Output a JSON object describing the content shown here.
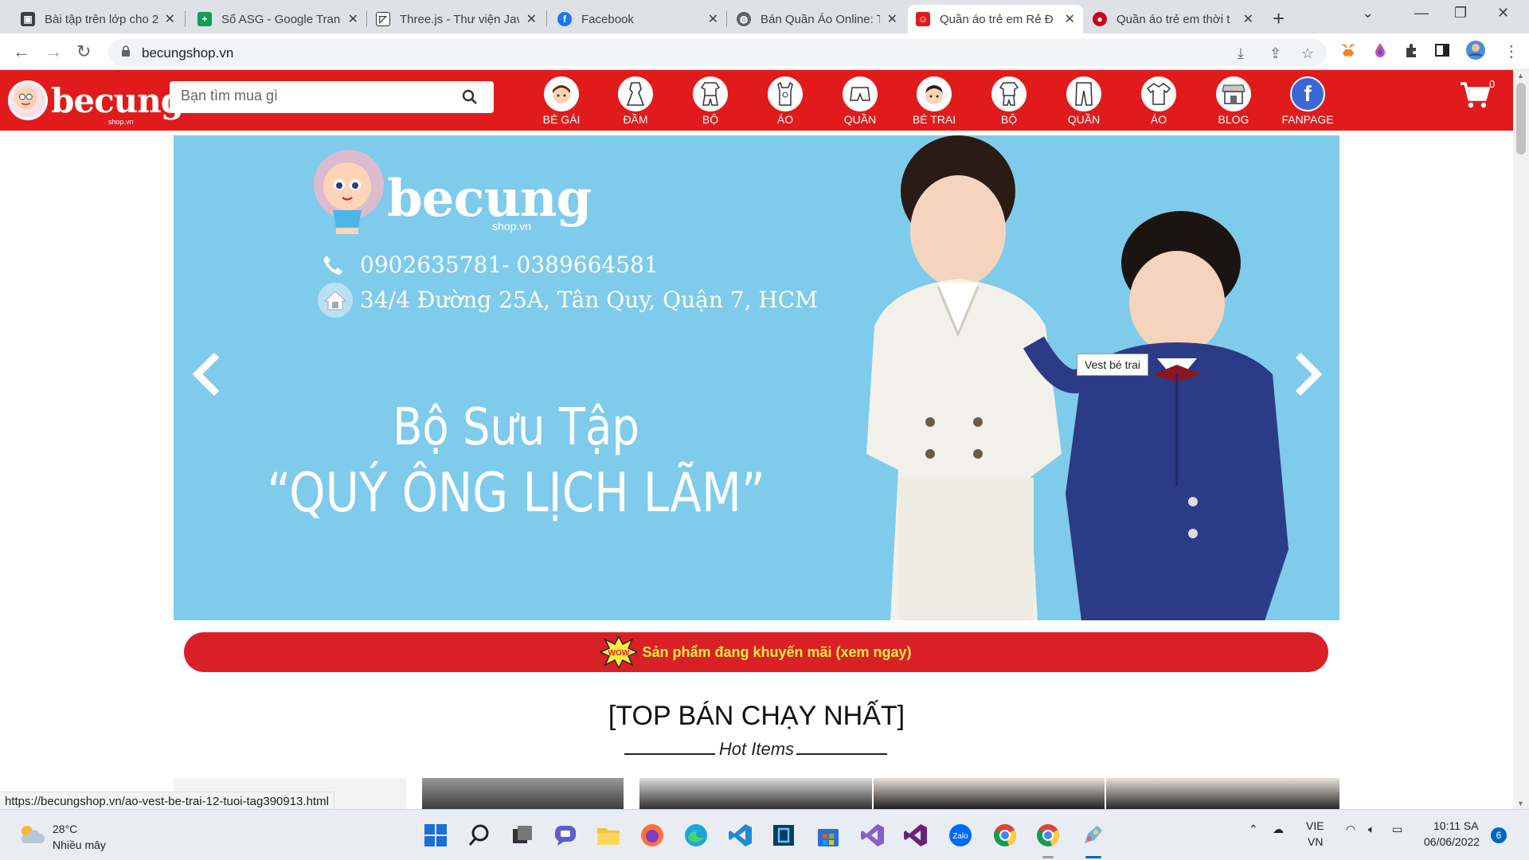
{
  "browser": {
    "tabs": [
      {
        "title": "Bài tập trên lớp cho 2",
        "favicon": "classroom-icon",
        "color": "#3c4043"
      },
      {
        "title": "Số ASG - Google Trang",
        "favicon": "sheets-icon",
        "color": "#0f9d58"
      },
      {
        "title": "Three.js - Thư viện Jav",
        "favicon": "threejs-icon",
        "color": "#333333"
      },
      {
        "title": "Facebook",
        "favicon": "facebook-icon",
        "color": "#1877f2"
      },
      {
        "title": "Bán Quần Áo Online: T",
        "favicon": "globe-icon",
        "color": "#5f6368"
      },
      {
        "title": "Quần áo trẻ em Rẻ Đ",
        "favicon": "becung-icon",
        "color": "#e11b1b"
      },
      {
        "title": "Quần áo trẻ em thời t",
        "favicon": "red-logo-icon",
        "color": "#d0021b"
      }
    ],
    "active_tab": 5,
    "url": "becungshop.vn"
  },
  "site": {
    "logo_text": "becung",
    "logo_sub": "shop.vn",
    "search_placeholder": "Bạn tìm mua gì",
    "categories": [
      {
        "label": "BÉ GÁI",
        "icon": "girl-icon"
      },
      {
        "label": "ĐẦM",
        "icon": "dress-icon"
      },
      {
        "label": "BỘ",
        "icon": "girl-set-icon"
      },
      {
        "label": "ÁO",
        "icon": "tanktop-icon"
      },
      {
        "label": "QUẦN",
        "icon": "shorts-icon"
      },
      {
        "label": "BÉ TRAI",
        "icon": "boy-icon"
      },
      {
        "label": "BỘ",
        "icon": "boy-set-icon"
      },
      {
        "label": "QUẦN",
        "icon": "pants-icon"
      },
      {
        "label": "ÁO",
        "icon": "shirt-icon"
      },
      {
        "label": "BLOG",
        "icon": "store-icon"
      },
      {
        "label": "FANPAGE",
        "icon": "facebook-icon"
      }
    ],
    "cart_count": "0"
  },
  "banner": {
    "logo_text": "becung",
    "logo_sub": "shop.vn",
    "phone": "0902635781- 0389664581",
    "address": "34/4 Đường 25A, Tân Quy, Quận 7, HCM",
    "title_line1": "Bộ Sưu Tập",
    "title_line2": "“QUÝ ÔNG LỊCH LÃM”",
    "tooltip": "Vest bé trai",
    "bg_color": "#7fcbeb"
  },
  "promo": {
    "text": "Sản phẩm đang khuyến mãi (xem ngay)",
    "badge": "WOW"
  },
  "sections": {
    "top_title": "[TOP BÁN CHẠY NHẤT]",
    "hot_items": "Hot Items"
  },
  "status_url": "https://becungshop.vn/ao-vest-be-trai-12-tuoi-tag390913.html",
  "taskbar": {
    "temperature": "28°C",
    "weather": "Nhiều mây",
    "lang1": "VIE",
    "lang2": "VN",
    "time": "10:11 SA",
    "date": "06/06/2022",
    "notifications": "6"
  }
}
